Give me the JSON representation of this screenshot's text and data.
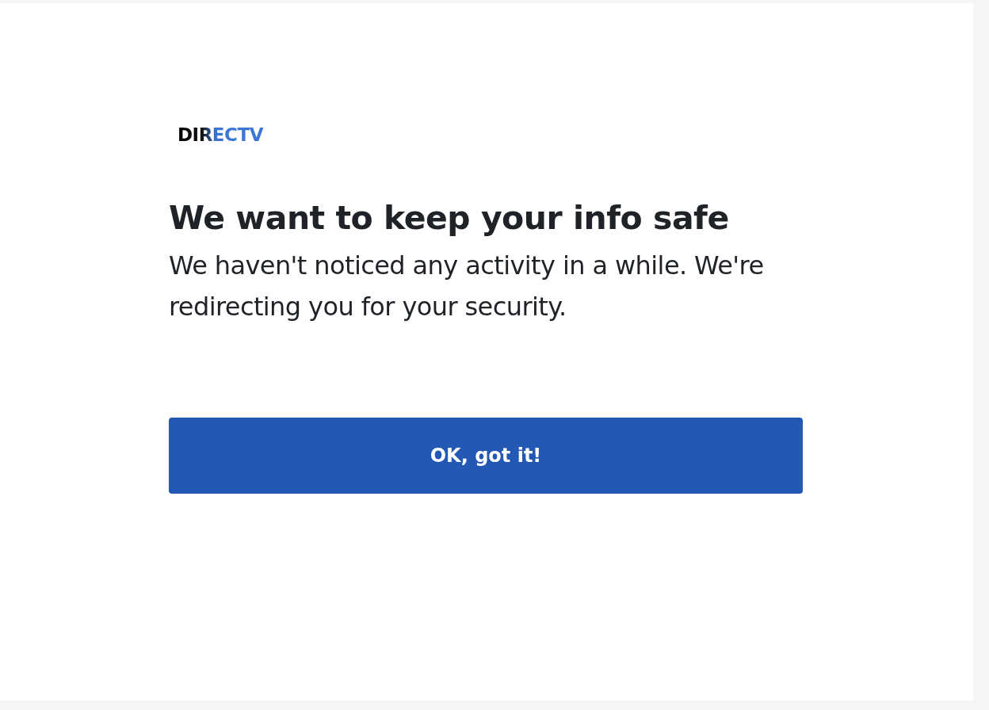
{
  "logo": "DIRECTV",
  "heading": "We want to keep your info safe",
  "message": "We haven't noticed any activity in a while. We're redirecting you for your security.",
  "button": "OK, got it!"
}
